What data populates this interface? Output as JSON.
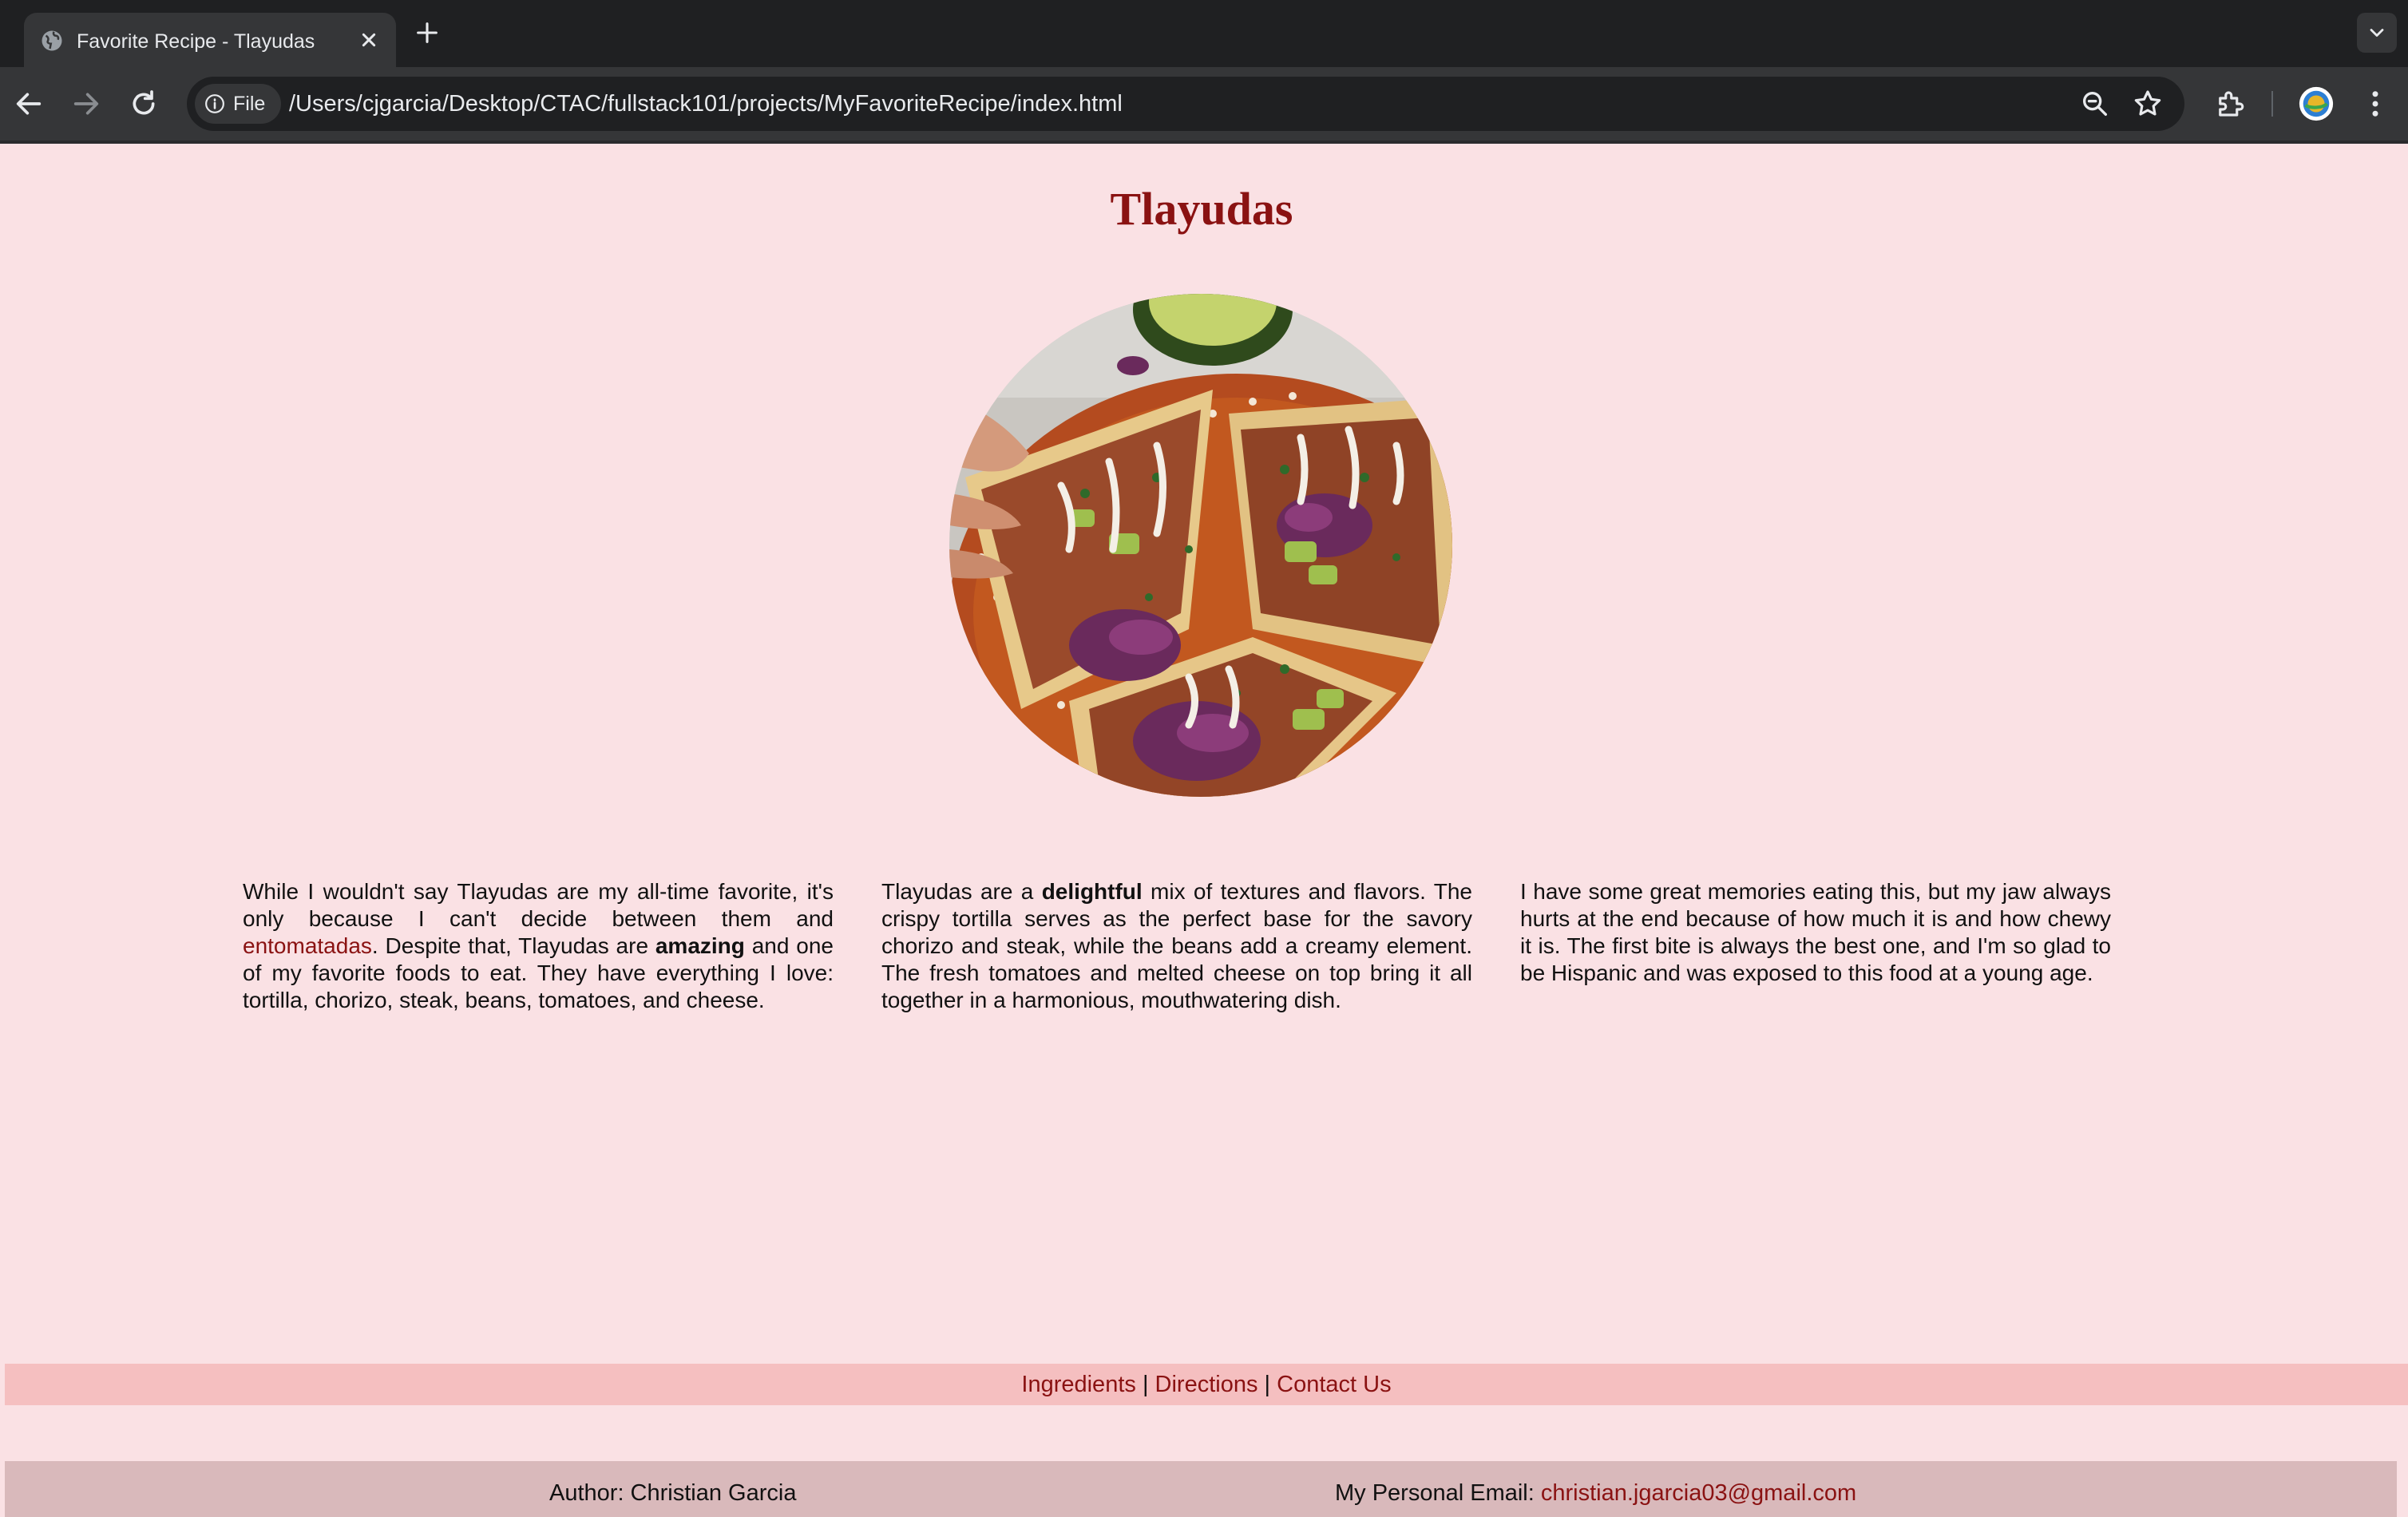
{
  "browser": {
    "tab_title": "Favorite Recipe - Tlayudas",
    "security_chip": "File",
    "url": "/Users/cjgarcia/Desktop/CTAC/fullstack101/projects/MyFavoriteRecipe/index.html"
  },
  "page": {
    "title": "Tlayudas",
    "image_alt": "Tlayudas with avocado, cabbage and crema",
    "col1": {
      "part1": "While I wouldn't say Tlayudas are my all-time favorite, it's only because I can't decide between them and ",
      "link": "entomatadas",
      "part2": ". Despite that, Tlayudas are ",
      "bold": "amazing",
      "part3": " and one of my favorite foods to eat. They have everything I love: tortilla, chorizo, steak, beans, tomatoes, and cheese."
    },
    "col2": {
      "part1": "Tlayudas are a ",
      "bold": "delightful",
      "part2": " mix of textures and flavors. The crispy tortilla serves as the perfect base for the savory chorizo and steak, while the beans add a creamy element. The fresh tomatoes and melted cheese on top bring it all together in a harmonious, mouthwatering dish."
    },
    "col3": {
      "text": "I have some great memories eating this, but my jaw always hurts at the end because of how much it is and how chewy it is. The first bite is always the best one, and I'm so glad to be Hispanic and was exposed to this food at a young age."
    },
    "nav": {
      "ingredients": "Ingredients",
      "separator": " | ",
      "directions": "Directions",
      "contact": "Contact Us"
    },
    "footer": {
      "author": "Author: Christian Garcia",
      "email_label": "My Personal Email: ",
      "email": "christian.jgarcia03@gmail.com"
    }
  },
  "colors": {
    "page_bg": "#fae1e4",
    "title": "#8a1212",
    "link": "#8a1212",
    "nav_bg": "#f5bfc0",
    "footer_bg": "#d9b9bb"
  },
  "icons": [
    "globe-icon",
    "close-icon",
    "plus-icon",
    "chevron-down-icon",
    "back-arrow-icon",
    "forward-arrow-icon",
    "reload-icon",
    "info-icon",
    "zoom-icon",
    "star-icon",
    "extensions-icon",
    "profile-avatar",
    "more-vert-icon"
  ]
}
